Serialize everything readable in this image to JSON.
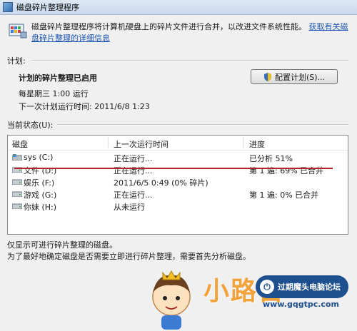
{
  "window": {
    "title": "磁盘碎片整理程序"
  },
  "header": {
    "description": "磁盘碎片整理程序将计算机硬盘上的碎片文件进行合并，以改进文件系统性能。",
    "link": "获取有关磁盘碎片整理的详细信息"
  },
  "schedule": {
    "section_label": "计划:",
    "title": "计划的碎片整理已启用",
    "frequency": "每星期三  1:00 运行",
    "next_run": "下一次计划运行时间: 2011/6/8 1:23",
    "configure_button": "配置计划(S)..."
  },
  "status": {
    "section_label": "当前状态(U):",
    "columns": [
      "磁盘",
      "上一次运行时间",
      "进度"
    ],
    "rows": [
      {
        "disk": "sys (C:)",
        "last_run": "正在运行...",
        "progress": "已分析 51%",
        "icon": "system-drive-icon"
      },
      {
        "disk": "文件 (D:)",
        "last_run": "正在运行...",
        "progress": "第 1 遍: 69% 已合并",
        "icon": "drive-icon"
      },
      {
        "disk": "娱乐 (F:)",
        "last_run": "2011/6/5 0:49 (0% 碎片)",
        "progress": "",
        "icon": "drive-icon"
      },
      {
        "disk": "游戏 (G:)",
        "last_run": "正在运行...",
        "progress": "第 1 遍: 0% 已合并",
        "icon": "drive-icon"
      },
      {
        "disk": "你妹 (H:)",
        "last_run": "从未运行",
        "progress": "",
        "icon": "drive-icon"
      }
    ]
  },
  "footer": {
    "note1": "仅显示可进行碎片整理的磁盘。",
    "note2": "为了最好地确定磁盘是否需要立即进行碎片整理，需要首先分析磁盘。"
  },
  "watermark": {
    "brand": "小路百",
    "badge": "过期魔头电脑论坛",
    "url": "www.gqgtpc.com"
  },
  "colors": {
    "link": "#1a55b0",
    "annotation_line": "#b5222d",
    "watermark": "#f2a23a"
  }
}
